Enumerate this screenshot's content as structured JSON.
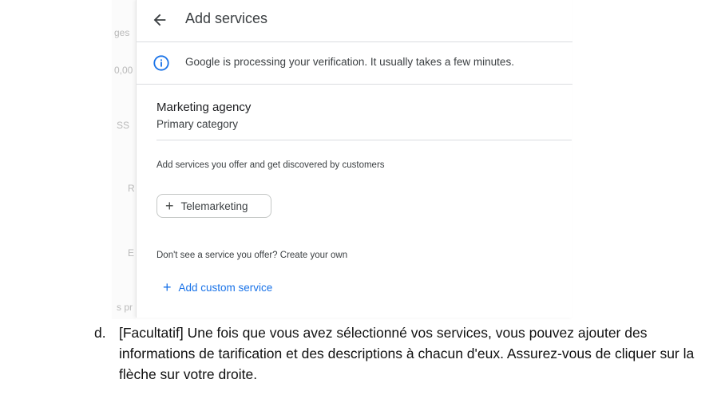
{
  "background_fragments": [
    "ges",
    "0,00",
    "SS",
    "R",
    "E",
    "s pr"
  ],
  "panel": {
    "header": {
      "title": "Add services",
      "back_icon": "arrow-back-icon"
    },
    "banner": {
      "icon": "info-icon",
      "text": "Google is processing your verification. It usually takes a few minutes.",
      "icon_color": "#1a73e8"
    },
    "category": {
      "name": "Marketing agency",
      "subtitle": "Primary category"
    },
    "services_helper": "Add services you offer and get discovered by customers",
    "service_chips": [
      {
        "label": "Telemarketing",
        "icon": "plus-icon"
      }
    ],
    "custom_helper": "Don't see a service you offer? Create your own",
    "add_custom": {
      "label": "Add custom service",
      "icon": "plus-icon",
      "color": "#1a73e8"
    }
  },
  "caption": {
    "marker": "d.",
    "text": "[Facultatif] Une fois que vous avez sélectionné vos services, vous pouvez ajouter des informations de tarification et des descriptions à chacun d'eux. Assurez-vous de cliquer sur la flèche sur votre droite."
  }
}
